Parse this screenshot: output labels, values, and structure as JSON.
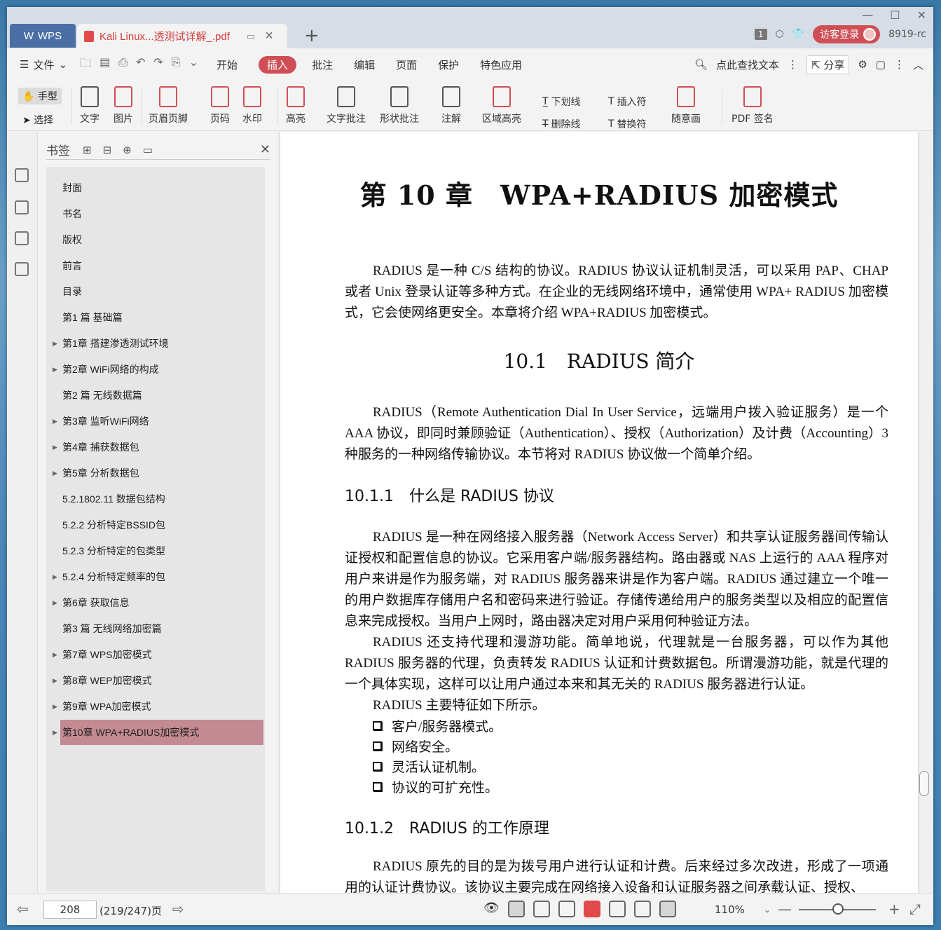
{
  "titlebar": {
    "app_tab": "WPS",
    "doc_tab": "Kali Linux...透测试详解_.pdf",
    "page_badge": "1",
    "login_label": "访客登录",
    "user_code": "8919-rc"
  },
  "menu": {
    "file": "文件",
    "items": [
      "开始",
      "插入",
      "批注",
      "编辑",
      "页面",
      "保护",
      "特色应用"
    ],
    "active": "插入",
    "search": "点此查找文本",
    "share": "分享"
  },
  "toolbar": {
    "hand": "手型",
    "select": "选择",
    "text": "文字",
    "image": "图片",
    "header_footer": "页眉页脚",
    "page_number": "页码",
    "watermark": "水印",
    "highlight": "高亮",
    "text_note": "文字批注",
    "shape_note": "形状批注",
    "annotate": "注解",
    "area_highlight": "区域高亮",
    "underline": "下划线",
    "strikethrough": "删除线",
    "insert_char": "插入符",
    "replace_char": "替换符",
    "freehand": "随意画",
    "pdf_sign": "PDF 签名"
  },
  "bookmarks": {
    "title": "书签",
    "items": [
      {
        "label": "封面",
        "arrow": false
      },
      {
        "label": "书名",
        "arrow": false
      },
      {
        "label": "版权",
        "arrow": false
      },
      {
        "label": "前言",
        "arrow": false
      },
      {
        "label": "目录",
        "arrow": false
      },
      {
        "label": "第1 篇 基础篇",
        "arrow": false
      },
      {
        "label": "第1章 搭建渗透测试环境",
        "arrow": true
      },
      {
        "label": "第2章 WiFi网络的构成",
        "arrow": true
      },
      {
        "label": "第2 篇 无线数据篇",
        "arrow": false
      },
      {
        "label": "第3章 监听WiFi网络",
        "arrow": true
      },
      {
        "label": "第4章 捕获数据包",
        "arrow": true
      },
      {
        "label": "第5章 分析数据包",
        "arrow": true
      },
      {
        "label": "5.2.1802.11 数据包结构",
        "arrow": false
      },
      {
        "label": "5.2.2 分析特定BSSID包",
        "arrow": false
      },
      {
        "label": "5.2.3 分析特定的包类型",
        "arrow": false
      },
      {
        "label": "5.2.4 分析特定频率的包",
        "arrow": true
      },
      {
        "label": "第6章 获取信息",
        "arrow": true
      },
      {
        "label": "第3 篇 无线网络加密篇",
        "arrow": false
      },
      {
        "label": "第7章 WPS加密模式",
        "arrow": true
      },
      {
        "label": "第8章 WEP加密模式",
        "arrow": true
      },
      {
        "label": "第9章 WPA加密模式",
        "arrow": true
      },
      {
        "label": "第10章 WPA+RADIUS加密模式",
        "arrow": true,
        "active": true
      }
    ]
  },
  "document": {
    "chapter_title": "第 10 章　WPA+RADIUS 加密模式",
    "intro": "RADIUS 是一种 C/S 结构的协议。RADIUS 协议认证机制灵活，可以采用 PAP、CHAP 或者 Unix 登录认证等多种方式。在企业的无线网络环境中，通常使用 WPA+ RADIUS 加密模式，它会使网络更安全。本章将介绍 WPA+RADIUS 加密模式。",
    "section_title": "10.1　RADIUS 简介",
    "section_intro": "RADIUS（Remote Authentication Dial In User Service，远端用户拨入验证服务）是一个 AAA 协议，即同时兼顾验证（Authentication）、授权（Authorization）及计费（Accounting）3 种服务的一种网络传输协议。本节将对 RADIUS 协议做一个简单介绍。",
    "sub1_title": "10.1.1　什么是 RADIUS 协议",
    "sub1_p1": "RADIUS 是一种在网络接入服务器（Network Access Server）和共享认证服务器间传输认证授权和配置信息的协议。它采用客户端/服务器结构。路由器或 NAS 上运行的 AAA 程序对用户来讲是作为服务端，对 RADIUS 服务器来讲是作为客户端。RADIUS 通过建立一个唯一的用户数据库存储用户名和密码来进行验证。存储传递给用户的服务类型以及相应的配置信息来完成授权。当用户上网时，路由器决定对用户采用何种验证方法。",
    "sub1_p2": "RADIUS 还支持代理和漫游功能。简单地说，代理就是一台服务器，可以作为其他 RADIUS 服务器的代理，负责转发 RADIUS 认证和计费数据包。所谓漫游功能，就是代理的一个具体实现，这样可以让用户通过本来和其无关的 RADIUS 服务器进行认证。",
    "sub1_p3": "RADIUS 主要特征如下所示。",
    "bullets": [
      "客户/服务器模式。",
      "网络安全。",
      "灵活认证机制。",
      "协议的可扩充性。"
    ],
    "sub2_title": "10.1.2　RADIUS 的工作原理",
    "sub2_p1": "RADIUS 原先的目的是为拨号用户进行认证和计费。后来经过多次改进，形成了一项通用的认证计费协议。该协议主要完成在网络接入设备和认证服务器之间承载认证、授权、"
  },
  "statusbar": {
    "page": "208",
    "page_total": "(219/247)页",
    "zoom": "110%"
  },
  "colors": {
    "accent": "#d04f56",
    "bookmark_active": "#c48a93",
    "app_tab": "#4a6fa5"
  }
}
